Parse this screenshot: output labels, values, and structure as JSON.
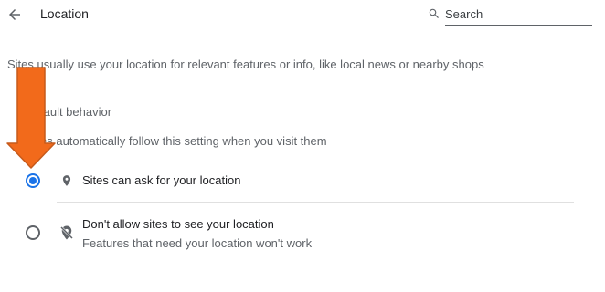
{
  "header": {
    "title": "Location",
    "search_placeholder": "Search"
  },
  "description": "Sites usually use your location for relevant features or info, like local news or nearby shops",
  "default_behavior": {
    "heading": "fault behavior",
    "subtitle": "es automatically follow this setting when you visit them",
    "options": [
      {
        "label": "Sites can ask for your location",
        "checked": true,
        "icon": "location-pin-icon"
      },
      {
        "label": "Don't allow sites to see your location",
        "sublabel": "Features that need your location won't work",
        "checked": false,
        "icon": "location-off-icon"
      }
    ]
  },
  "colors": {
    "accent": "#1a73e8",
    "annotation_arrow": "#f26a1b"
  }
}
